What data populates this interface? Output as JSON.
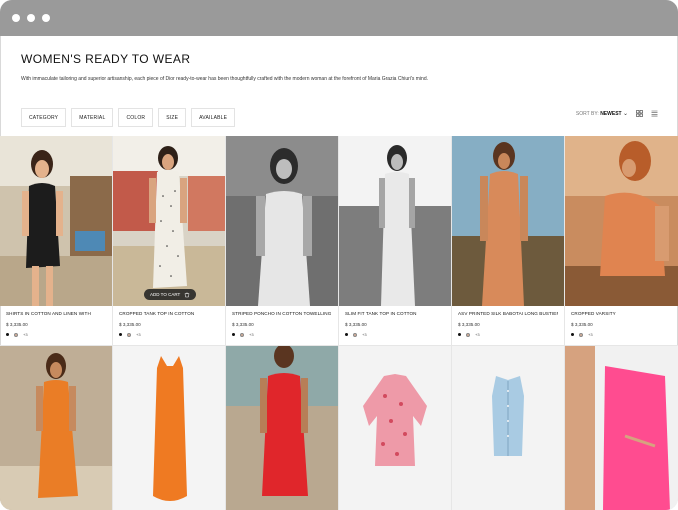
{
  "window": {
    "controls": [
      "close",
      "minimize",
      "maximize"
    ]
  },
  "header": {
    "title": "WOMEN'S READY TO WEAR",
    "description": "With immaculate tailoring and superior artisanship, each piece of Dior ready-to-wear has been thoughtfully crafted with the modern woman at the forefront of Maria Grazia Chiuri's mind."
  },
  "filters": [
    "CATEGORY",
    "MATERIAL",
    "COLOR",
    "SIZE",
    "AVAILABLE"
  ],
  "sort": {
    "label": "SORT BY:",
    "value": "NEWEST"
  },
  "add_to_cart_label": "ADD TO CART",
  "products_row1": [
    {
      "name": "SHIRTS IN COTTON AND LINEN WITH",
      "price": "$ 3,335.00",
      "more": "+3"
    },
    {
      "name": "CROPPED TANK TOP IN COTTON",
      "price": "$ 3,335.00",
      "more": "+3"
    },
    {
      "name": "STRIPED PONCHO IN COTTON TOWELLING",
      "price": "$ 3,335.00",
      "more": "+3"
    },
    {
      "name": "SLIM FIT TANK TOP IN COTTON",
      "price": "$ 3,335.00",
      "more": "+3"
    },
    {
      "name": "ASV PRINTED SILK BABOTAI LONG BUSTIER",
      "price": "$ 3,335.00",
      "more": "+3"
    },
    {
      "name": "CROPPED VARSITY",
      "price": "$ 3,335.00",
      "more": "+3"
    }
  ],
  "colors": {
    "titlebar": "#9a9a9a",
    "orange": "#e2761f",
    "red": "#d8262a",
    "pink": "#ff4f91",
    "denim": "#a9cce3"
  }
}
